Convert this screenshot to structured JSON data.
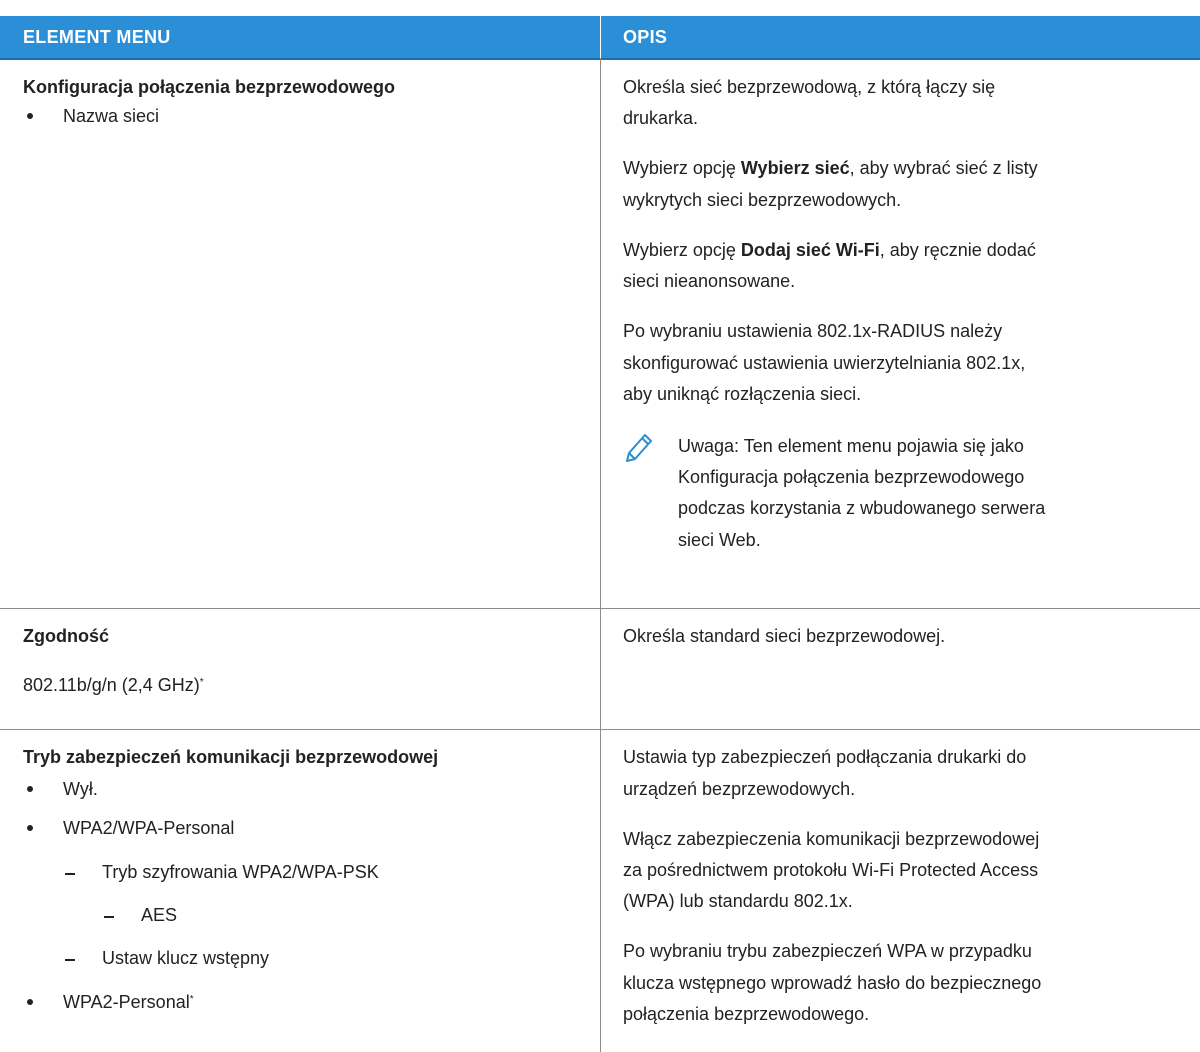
{
  "header": {
    "col1": "ELEMENT MENU",
    "col2": "OPIS"
  },
  "row1": {
    "title": "Konfiguracja połączenia bezprzewodowego",
    "item": "Nazwa sieci",
    "desc_line1": "Określa sieć bezprzewodową, z którą łączy się",
    "desc_line2": "drukarka.",
    "p2_pre": "Wybierz opcję ",
    "p2_bold": "Wybierz sieć",
    "p2_post": ", aby wybrać sieć z listy",
    "p2_line2": "wykrytych sieci bezprzewodowych.",
    "p3_pre": "Wybierz opcję ",
    "p3_bold": "Dodaj sieć Wi-Fi",
    "p3_post": ", aby ręcznie dodać",
    "p3_line2": "sieci nieanonsowane.",
    "p4_line1": "Po wybraniu ustawienia 802.1x-RADIUS należy",
    "p4_line2": "skonfigurować ustawienia uwierzytelniania 802.1x,",
    "p4_line3": "aby uniknąć rozłączenia sieci.",
    "note_line1": "Uwaga: Ten element menu pojawia się jako",
    "note_line2": "Konfiguracja połączenia bezprzewodowego",
    "note_line3": "podczas korzystania z wbudowanego serwera",
    "note_line4": "sieci Web."
  },
  "row2": {
    "title": "Zgodność",
    "value": "802.11b/g/n (2,4 GHz)",
    "asterisk": "*",
    "desc": "Określa standard sieci bezprzewodowej."
  },
  "row3": {
    "title": "Tryb zabezpieczeń komunikacji bezprzewodowej",
    "item1": "Wył.",
    "item2": "WPA2/WPA-Personal",
    "sub1": "Tryb szyfrowania WPA2/WPA-PSK",
    "subsub1": "AES",
    "sub2": "Ustaw klucz wstępny",
    "item3": "WPA2-Personal",
    "asterisk": "*",
    "d1_line1": "Ustawia typ zabezpieczeń podłączania drukarki do",
    "d1_line2": "urządzeń bezprzewodowych.",
    "d2_line1": "Włącz zabezpieczenia komunikacji bezprzewodowej",
    "d2_line2": "za pośrednictwem protokołu Wi-Fi Protected Access",
    "d2_line3": "(WPA) lub standardu 802.1x.",
    "d3_line1": "Po wybraniu trybu zabezpieczeń WPA w przypadku",
    "d3_line2": "klucza wstępnego wprowadź hasło do bezpiecznego",
    "d3_line3": "połączenia bezprzewodowego."
  },
  "colors": {
    "header_bg": "#2a8fd7",
    "rule": "#8c8c8c",
    "text": "#222222"
  },
  "icons": {
    "note": "pencil-icon"
  }
}
